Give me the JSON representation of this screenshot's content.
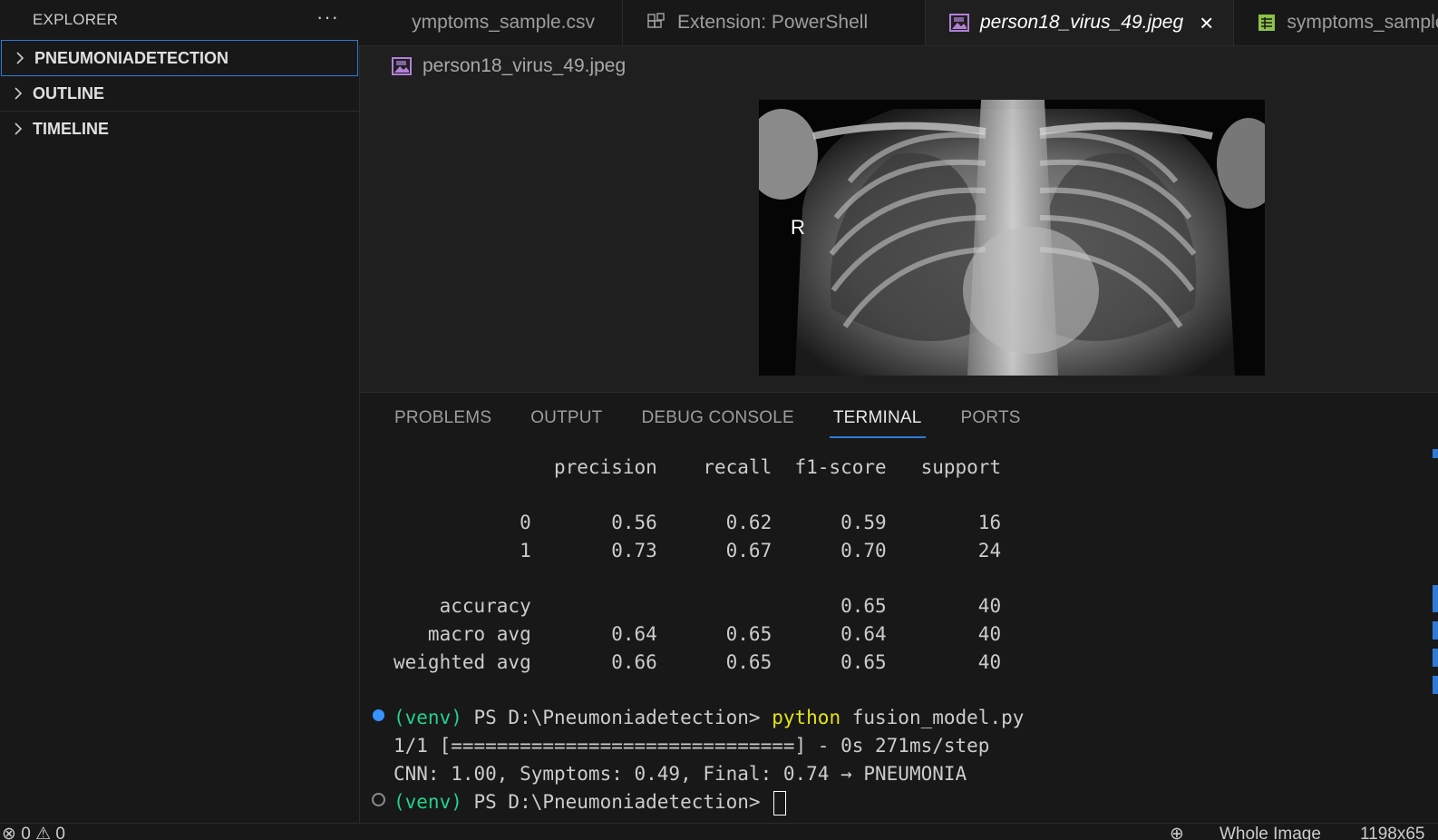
{
  "sidebar": {
    "title": "EXPLORER",
    "more": "···",
    "sections": [
      {
        "label": "PNEUMONIADETECTION"
      },
      {
        "label": "OUTLINE"
      },
      {
        "label": "TIMELINE"
      }
    ]
  },
  "tabs": [
    {
      "label": "ymptoms_sample.csv"
    },
    {
      "label": "Extension: PowerShell"
    },
    {
      "label": "person18_virus_49.jpeg",
      "close": "×"
    },
    {
      "label": "symptoms_sample_"
    }
  ],
  "breadcrumb": {
    "file": "person18_virus_49.jpeg"
  },
  "image": {
    "marker": "R"
  },
  "panel": {
    "tabs": [
      "PROBLEMS",
      "OUTPUT",
      "DEBUG CONSOLE",
      "TERMINAL",
      "PORTS"
    ],
    "active_tab": "TERMINAL"
  },
  "terminal": {
    "report_header": "              precision    recall  f1-score   support",
    "rows": [
      "           0       0.56      0.62      0.59        16",
      "           1       0.73      0.67      0.70        24",
      "    accuracy                           0.65        40",
      "   macro avg       0.64      0.65      0.64        40",
      "weighted avg       0.66      0.65      0.65        40"
    ],
    "prompt_venv": "(venv)",
    "prompt_path": " PS D:\\Pneumoniadetection> ",
    "command_name": "python",
    "command_args": " fusion_model.py",
    "progress_line": "1/1 [==============================] - 0s 271ms/step",
    "result_line": "CNN: 1.00, Symptoms: 0.49, Final: 0.74 → PNEUMONIA"
  },
  "statusbar": {
    "errors": "0",
    "warnings": "0",
    "image_mode": "Whole Image",
    "dimensions": "1198x65"
  },
  "colors": {
    "accent": "#2f7ad6",
    "venv_green": "#23d18b",
    "command_yellow": "#e5e510",
    "image_icon_purple": "#b180d7",
    "csv_icon_green": "#8dc149"
  }
}
